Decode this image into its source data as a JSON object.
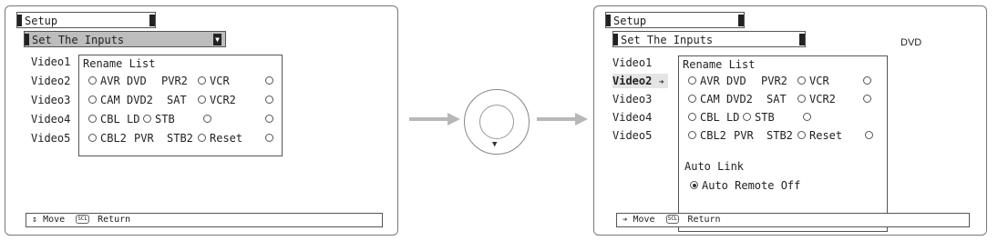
{
  "left_screen": {
    "setup_label": "Setup",
    "inputs_label": "Set The Inputs",
    "dropdown_glyph": "▼",
    "videos": [
      "Video1",
      "Video2",
      "Video3",
      "Video4",
      "Video5"
    ],
    "popup_title": "Rename List",
    "rows": [
      [
        "AVR",
        "DVD",
        "PVR2",
        "VCR",
        ""
      ],
      [
        "CAM",
        "DVD2",
        "SAT",
        "VCR2",
        ""
      ],
      [
        "CBL",
        "LD",
        "STB",
        "",
        ""
      ],
      [
        "CBL2",
        "PVR",
        "STB2",
        "Reset",
        ""
      ]
    ],
    "footer": {
      "move_glyph": "⇕",
      "move_label": "Move",
      "key_label": "SCL",
      "return_label": "Return"
    }
  },
  "right_screen": {
    "setup_label": "Setup",
    "inputs_label": "Set The Inputs",
    "current_input": "DVD",
    "videos": [
      "Video1",
      "Video2",
      "Video3",
      "Video4",
      "Video5"
    ],
    "selected_video_index": 1,
    "selected_arrow": "➔",
    "popup_title": "Rename List",
    "rows": [
      [
        "AVR",
        "DVD",
        "PVR2",
        "VCR",
        ""
      ],
      [
        "CAM",
        "DVD2",
        "SAT",
        "VCR2",
        ""
      ],
      [
        "CBL",
        "LD",
        "STB",
        ""
      ],
      [
        "CBL2",
        "PVR",
        "STB2",
        "Reset",
        ""
      ]
    ],
    "auto_link_title": "Auto Link",
    "auto_link_option": "Auto Remote Off",
    "footer": {
      "move_glyph": "➔",
      "move_label": "Move",
      "key_label": "SCL",
      "return_label": "Return"
    }
  },
  "remote": {
    "direction_glyph": "▼"
  },
  "colors": {
    "arrow": "#b8b8b8",
    "header_gray": "#bdbdbd"
  }
}
